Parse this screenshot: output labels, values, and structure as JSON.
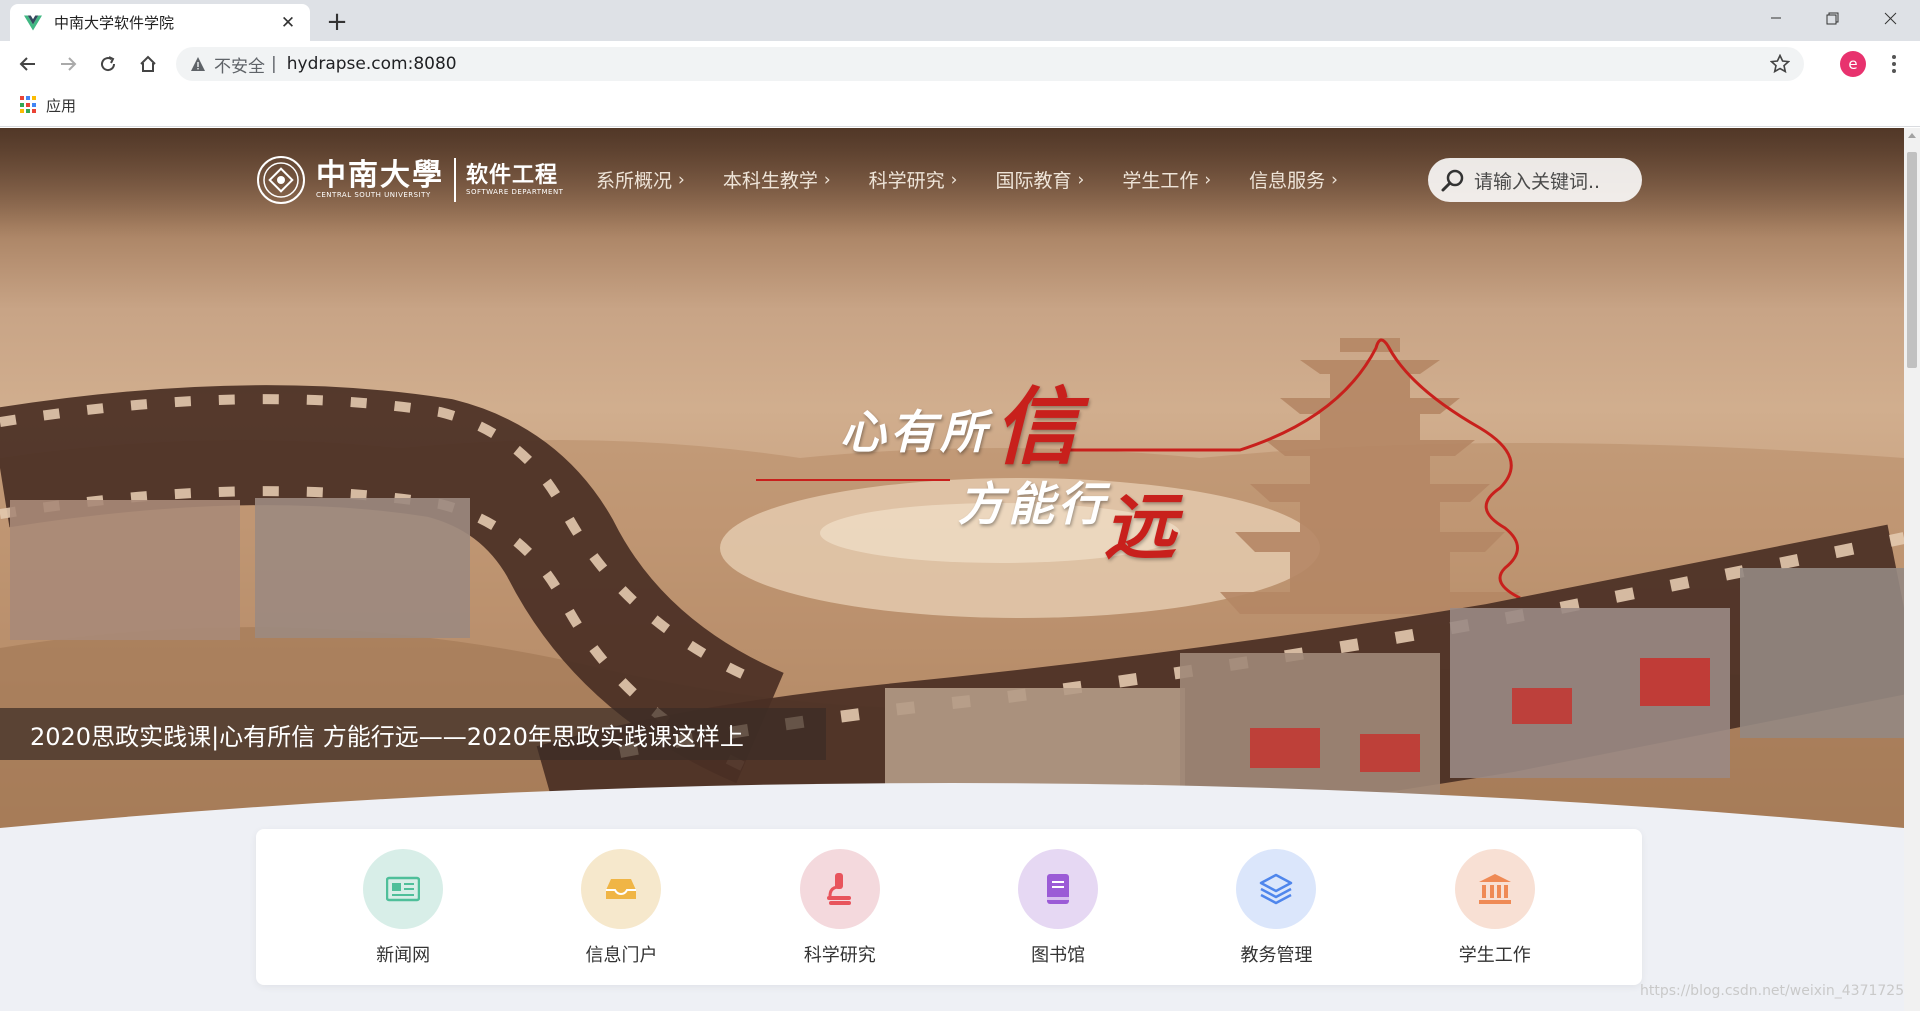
{
  "browser": {
    "tab_title": "中南大学软件学院",
    "new_tab_icon": "plus-icon",
    "insecure_label": "不安全",
    "separator": "|",
    "url": "hydrapse.com:8080",
    "profile_initial": "e",
    "bookmark_apps_label": "应用"
  },
  "site": {
    "logo_cn": "中南大學",
    "logo_en": "CENTRAL SOUTH UNIVERSITY",
    "dept_cn": "软件工程",
    "dept_en": "SOFTWARE DEPARTMENT",
    "nav": [
      {
        "label": "系所概况"
      },
      {
        "label": "本科生教学"
      },
      {
        "label": "科学研究"
      },
      {
        "label": "国际教育"
      },
      {
        "label": "学生工作"
      },
      {
        "label": "信息服务"
      }
    ],
    "nav_chevron": "›",
    "search_placeholder": "请输入关键词.."
  },
  "hero": {
    "slogan_line1": "心有所",
    "slogan_line1_big": "信",
    "slogan_line2": "方能行",
    "slogan_line2_big": "远",
    "caption": "2020思政实践课|心有所信 方能行远——2020年思政实践课这样上"
  },
  "quick_links": [
    {
      "label": "新闻网",
      "icon": "newspaper-icon",
      "bg": "#d8eee8",
      "color": "#4fbf9a"
    },
    {
      "label": "信息门户",
      "icon": "inbox-icon",
      "bg": "#f6e8cc",
      "color": "#f0b545"
    },
    {
      "label": "科学研究",
      "icon": "microscope-icon",
      "bg": "#f4d9dd",
      "color": "#e8545c"
    },
    {
      "label": "图书馆",
      "icon": "book-icon",
      "bg": "#e6d8f3",
      "color": "#9b5bd6"
    },
    {
      "label": "教务管理",
      "icon": "layers-icon",
      "bg": "#dbe6fb",
      "color": "#4f86ec"
    },
    {
      "label": "学生工作",
      "icon": "institution-icon",
      "bg": "#f8e0d4",
      "color": "#ef8a55"
    }
  ],
  "watermark": "https://blog.csdn.net/weixin_43717253",
  "colors": {
    "accent_red": "#c8201c",
    "profile": "#e8326e"
  }
}
